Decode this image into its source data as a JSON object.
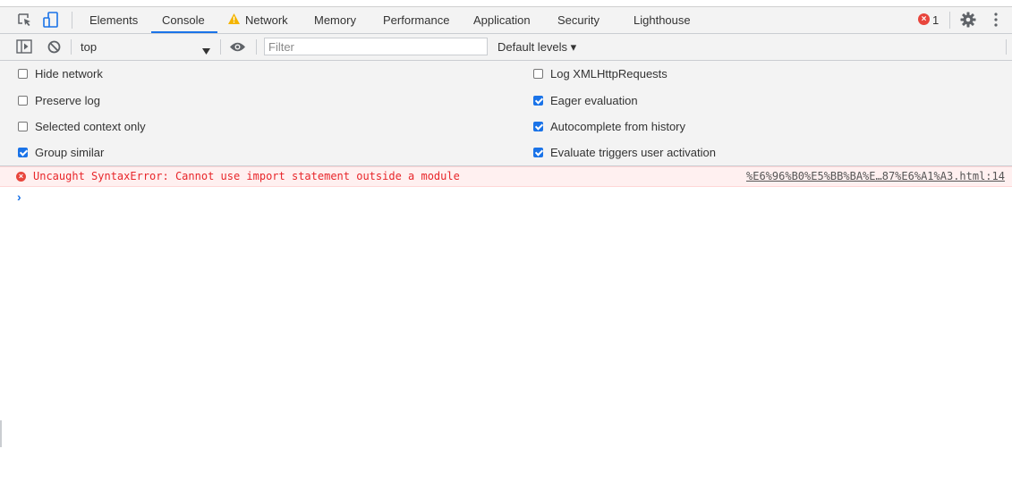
{
  "tabs": {
    "elements": "Elements",
    "console": "Console",
    "network": "Network",
    "memory": "Memory",
    "performance": "Performance",
    "application": "Application",
    "security": "Security",
    "lighthouse": "Lighthouse"
  },
  "errors_badge": {
    "count": "1"
  },
  "toolbar": {
    "context": "top",
    "filter_placeholder": "Filter",
    "levels": "Default levels ▾"
  },
  "settings": {
    "left": [
      {
        "label": "Hide network",
        "checked": false
      },
      {
        "label": "Preserve log",
        "checked": false
      },
      {
        "label": "Selected context only",
        "checked": false
      },
      {
        "label": "Group similar",
        "checked": true
      }
    ],
    "right": [
      {
        "label": "Log XMLHttpRequests",
        "checked": false
      },
      {
        "label": "Eager evaluation",
        "checked": true
      },
      {
        "label": "Autocomplete from history",
        "checked": true
      },
      {
        "label": "Evaluate triggers user activation",
        "checked": true
      }
    ]
  },
  "console_messages": [
    {
      "level": "error",
      "text": "Uncaught SyntaxError: Cannot use import statement outside a module",
      "source": "%E6%96%B0%E5%BB%BA%E…87%E6%A1%A3.html:14"
    }
  ],
  "prompt_symbol": "›",
  "colors": {
    "accent": "#1a73e8",
    "error": "#e8262a",
    "error_bg": "#fff0f0",
    "warning": "#f4b400",
    "toolbar_bg": "#f3f3f3"
  }
}
